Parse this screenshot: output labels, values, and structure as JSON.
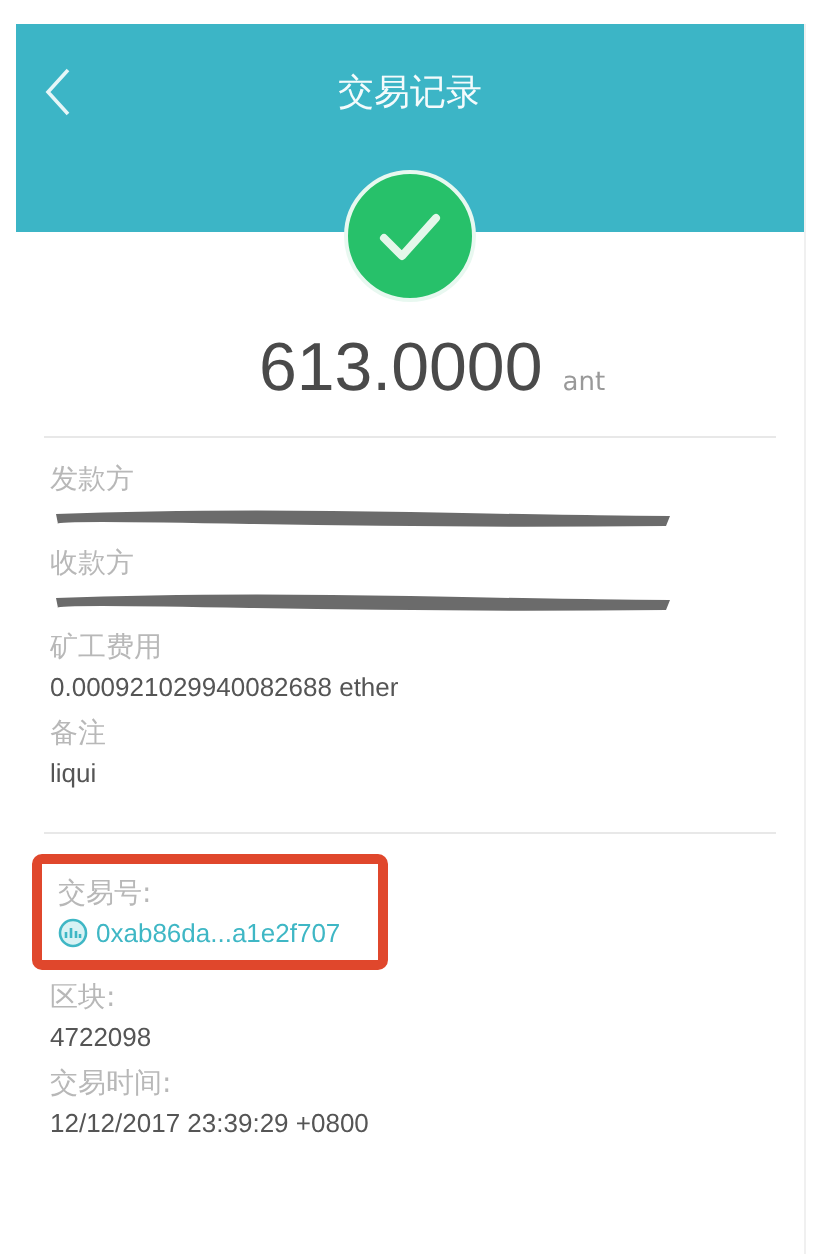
{
  "header": {
    "title": "交易记录"
  },
  "status": {
    "success": true
  },
  "amount": {
    "value": "613.0000",
    "unit": "ant"
  },
  "details": [
    {
      "label": "发款方",
      "kind": "redacted"
    },
    {
      "label": "收款方",
      "kind": "redacted"
    },
    {
      "label": "矿工费用",
      "kind": "text",
      "value": "0.000921029940082688 ether"
    },
    {
      "label": "备注",
      "kind": "text",
      "value": "liqui"
    }
  ],
  "chain_info": [
    {
      "label": "交易号:",
      "kind": "link",
      "value": "0xab86da...a1e2f707",
      "highlighted": true
    },
    {
      "label": "区块:",
      "kind": "text",
      "value": "4722098",
      "highlighted": false
    },
    {
      "label": "交易时间:",
      "kind": "text",
      "value": "12/12/2017 23:39:29 +0800",
      "highlighted": false
    }
  ]
}
